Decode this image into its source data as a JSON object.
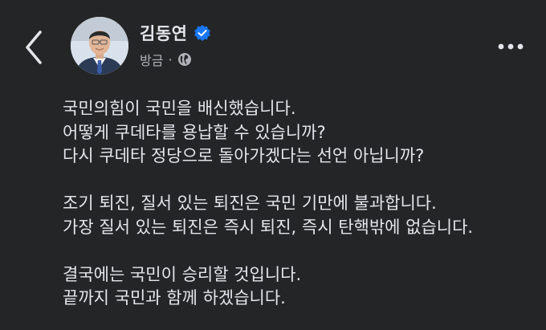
{
  "header": {
    "back_icon": "chevron-left-icon",
    "author_name": "김동연",
    "verified_icon": "verified-badge-icon",
    "timestamp": "방금",
    "separator": "·",
    "audience_icon": "globe-icon",
    "more_icon": "more-horizontal-icon"
  },
  "post": {
    "paragraphs": [
      [
        "국민의힘이 국민을 배신했습니다.",
        "어떻게 쿠데타를 용납할 수 있습니까?",
        "다시 쿠데타 정당으로 돌아가겠다는 선언 아닙니까?"
      ],
      [
        "조기 퇴진, 질서 있는 퇴진은 국민 기만에 불과합니다.",
        "가장 질서 있는 퇴진은 즉시 퇴진, 즉시 탄핵밖에 없습니다."
      ],
      [
        "결국에는 국민이 승리할 것입니다.",
        "끝까지 국민과 함께 하겠습니다."
      ]
    ]
  },
  "colors": {
    "background": "#242526",
    "text": "#e4e6eb",
    "secondary_text": "#b0b3b8",
    "verified_blue": "#1877f2"
  }
}
